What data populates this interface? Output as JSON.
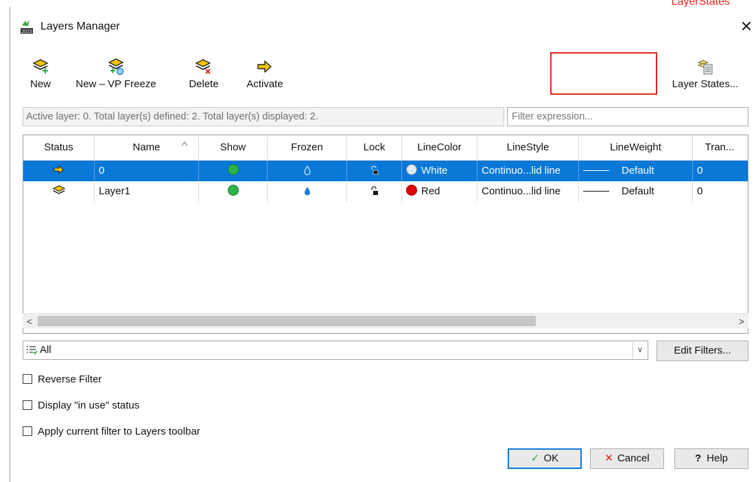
{
  "annotation": {
    "label": "LayerStates",
    "color": "#e2231a"
  },
  "window": {
    "title": "Layers Manager",
    "close_icon": "close-icon"
  },
  "toolbar": {
    "new_label": "New",
    "new_vp_freeze_label": "New – VP Freeze",
    "delete_label": "Delete",
    "activate_label": "Activate",
    "layer_states_label": "Layer States..."
  },
  "status_text": "Active layer: 0. Total layer(s) defined: 2. Total layer(s) displayed: 2.",
  "filter_expression": {
    "placeholder": "Filter expression...",
    "value": ""
  },
  "table": {
    "columns": [
      "Status",
      "Name",
      "Show",
      "Frozen",
      "Lock",
      "LineColor",
      "LineStyle",
      "LineWeight",
      "Tran..."
    ],
    "sorted_column": "Name",
    "rows": [
      {
        "selected": true,
        "status_icon": "arrow-right-icon",
        "name": "0",
        "show": "on",
        "frozen": "no",
        "lock": "unlocked",
        "line_color_name": "White",
        "line_color_hex": "#dfe9f3",
        "line_style": "Continuo...lid line",
        "line_weight": "Default",
        "transparency": "0"
      },
      {
        "selected": false,
        "status_icon": "layer-icon",
        "name": "Layer1",
        "show": "on",
        "frozen": "no",
        "lock": "unlocked",
        "line_color_name": "Red",
        "line_color_hex": "#e00000",
        "line_style": "Continuo...lid line",
        "line_weight": "Default",
        "transparency": "0"
      }
    ]
  },
  "filter": {
    "selected": "All",
    "edit_filters_label": "Edit Filters..."
  },
  "options": {
    "reverse_filter": "Reverse Filter",
    "display_in_use": "Display \"in use\" status",
    "apply_filter_toolbar": "Apply current filter to Layers toolbar"
  },
  "buttons": {
    "ok": "OK",
    "cancel": "Cancel",
    "help": "Help",
    "help_glyph": "?"
  },
  "colors": {
    "selection": "#0a78d7",
    "accent_red": "#e2231a",
    "show_green": "#2db34a",
    "frozen_blue": "#1e7fd6",
    "icon_yellow": "#f2c500"
  }
}
